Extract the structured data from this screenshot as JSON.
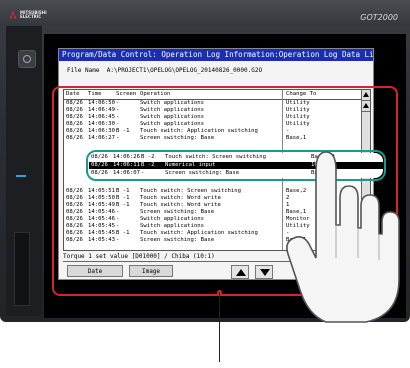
{
  "device": {
    "brand_line1": "MITSUBISHI",
    "brand_line2": "ELECTRIC",
    "model": "GOT2000",
    "colors": {
      "bezel": "#2b2e33",
      "led": "#2aa6d8",
      "highlight_red": "#d4262d",
      "zoom_teal": "#1a9a8c",
      "titlebar_blue": "#1b2db8"
    }
  },
  "window": {
    "title": "Program/Data Control: Operation Log Information:Operation Log Data List",
    "file_label": "File Name",
    "file_path": "A:\\PROJECT1\\OPELOG\\OPELOG_20140826_0000.G2O"
  },
  "table": {
    "headers": {
      "date": "Date",
      "time": "Time",
      "screen": "Screen No.",
      "operation": "Operation",
      "change_to": "Change To"
    },
    "rows_top": [
      {
        "date": "08/26",
        "time": "14:06:50",
        "screen": "-",
        "operation": "Switch applications",
        "change_to": "Utility"
      },
      {
        "date": "08/26",
        "time": "14:06:49",
        "screen": "-",
        "operation": "Switch applications",
        "change_to": "Utility"
      },
      {
        "date": "08/26",
        "time": "14:06:45",
        "screen": "-",
        "operation": "Switch applications",
        "change_to": "Utility"
      },
      {
        "date": "08/26",
        "time": "14:06:30",
        "screen": "-",
        "operation": "Switch applications",
        "change_to": "Utility"
      },
      {
        "date": "08/26",
        "time": "14:06:30",
        "screen": "B -1",
        "operation": "Touch switch: Application switching",
        "change_to": "-"
      },
      {
        "date": "08/26",
        "time": "14:06:27",
        "screen": "-",
        "operation": "Screen switching: Base",
        "change_to": "Base,1"
      }
    ],
    "rows_zoom": [
      {
        "date": "08/26",
        "time": "14:06:26",
        "screen": "B -2",
        "operation": "Touch switch: Screen switching",
        "change_to": "Base,20"
      },
      {
        "date": "08/26",
        "time": "14:06:11",
        "screen": "B -2",
        "operation": "Numerical input",
        "change_to": "100",
        "selected": true
      },
      {
        "date": "08/26",
        "time": "14:06:07",
        "screen": "-",
        "operation": "Screen switching: Base",
        "change_to": "Base,2"
      }
    ],
    "rows_bottom": [
      {
        "date": "08/26",
        "time": "14:05:51",
        "screen": "B -1",
        "operation": "Touch switch: Screen switching",
        "change_to": "Base,2"
      },
      {
        "date": "08/26",
        "time": "14:05:50",
        "screen": "B -1",
        "operation": "Touch switch: Word write",
        "change_to": "2"
      },
      {
        "date": "08/26",
        "time": "14:05:49",
        "screen": "B -1",
        "operation": "Touch switch: Word write",
        "change_to": "1"
      },
      {
        "date": "08/26",
        "time": "14:05:46",
        "screen": "-",
        "operation": "Screen switching: Base",
        "change_to": "Base,1"
      },
      {
        "date": "08/26",
        "time": "14:05:46",
        "screen": "-",
        "operation": "Switch applications",
        "change_to": "Monitor"
      },
      {
        "date": "08/26",
        "time": "14:05:45",
        "screen": "-",
        "operation": "Switch applications",
        "change_to": "Utility"
      },
      {
        "date": "08/26",
        "time": "14:05:45",
        "screen": "B -1",
        "operation": "Touch switch: Application switching",
        "change_to": "-"
      },
      {
        "date": "08/26",
        "time": "14:05:43",
        "screen": "-",
        "operation": "Screen switching: Base",
        "change_to": "Base,1"
      }
    ]
  },
  "footer": {
    "detail": "Torque 1 set value [D01000] / Chiba (10:1)",
    "sort_button": "Date (descending)",
    "image_button": "Image"
  }
}
